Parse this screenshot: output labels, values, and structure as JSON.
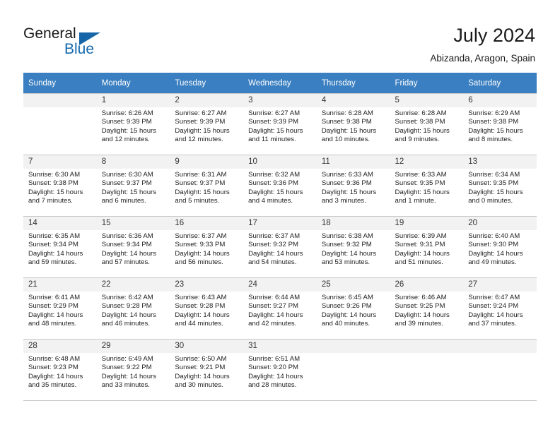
{
  "brand": {
    "name_part1": "General",
    "name_part2": "Blue",
    "triangle_color": "#1565a8",
    "blue_text_color": "#1268ad"
  },
  "header": {
    "title": "July 2024",
    "subtitle": "Abizanda, Aragon, Spain"
  },
  "calendar": {
    "header_bg": "#3a7fc1",
    "daynum_bg": "#f2f2f2",
    "weekday_headers": [
      "Sunday",
      "Monday",
      "Tuesday",
      "Wednesday",
      "Thursday",
      "Friday",
      "Saturday"
    ],
    "weeks": [
      [
        {
          "day": "",
          "details": ""
        },
        {
          "day": "1",
          "details": "Sunrise: 6:26 AM\nSunset: 9:39 PM\nDaylight: 15 hours\nand 12 minutes."
        },
        {
          "day": "2",
          "details": "Sunrise: 6:27 AM\nSunset: 9:39 PM\nDaylight: 15 hours\nand 12 minutes."
        },
        {
          "day": "3",
          "details": "Sunrise: 6:27 AM\nSunset: 9:39 PM\nDaylight: 15 hours\nand 11 minutes."
        },
        {
          "day": "4",
          "details": "Sunrise: 6:28 AM\nSunset: 9:38 PM\nDaylight: 15 hours\nand 10 minutes."
        },
        {
          "day": "5",
          "details": "Sunrise: 6:28 AM\nSunset: 9:38 PM\nDaylight: 15 hours\nand 9 minutes."
        },
        {
          "day": "6",
          "details": "Sunrise: 6:29 AM\nSunset: 9:38 PM\nDaylight: 15 hours\nand 8 minutes."
        }
      ],
      [
        {
          "day": "7",
          "details": "Sunrise: 6:30 AM\nSunset: 9:38 PM\nDaylight: 15 hours\nand 7 minutes."
        },
        {
          "day": "8",
          "details": "Sunrise: 6:30 AM\nSunset: 9:37 PM\nDaylight: 15 hours\nand 6 minutes."
        },
        {
          "day": "9",
          "details": "Sunrise: 6:31 AM\nSunset: 9:37 PM\nDaylight: 15 hours\nand 5 minutes."
        },
        {
          "day": "10",
          "details": "Sunrise: 6:32 AM\nSunset: 9:36 PM\nDaylight: 15 hours\nand 4 minutes."
        },
        {
          "day": "11",
          "details": "Sunrise: 6:33 AM\nSunset: 9:36 PM\nDaylight: 15 hours\nand 3 minutes."
        },
        {
          "day": "12",
          "details": "Sunrise: 6:33 AM\nSunset: 9:35 PM\nDaylight: 15 hours\nand 1 minute."
        },
        {
          "day": "13",
          "details": "Sunrise: 6:34 AM\nSunset: 9:35 PM\nDaylight: 15 hours\nand 0 minutes."
        }
      ],
      [
        {
          "day": "14",
          "details": "Sunrise: 6:35 AM\nSunset: 9:34 PM\nDaylight: 14 hours\nand 59 minutes."
        },
        {
          "day": "15",
          "details": "Sunrise: 6:36 AM\nSunset: 9:34 PM\nDaylight: 14 hours\nand 57 minutes."
        },
        {
          "day": "16",
          "details": "Sunrise: 6:37 AM\nSunset: 9:33 PM\nDaylight: 14 hours\nand 56 minutes."
        },
        {
          "day": "17",
          "details": "Sunrise: 6:37 AM\nSunset: 9:32 PM\nDaylight: 14 hours\nand 54 minutes."
        },
        {
          "day": "18",
          "details": "Sunrise: 6:38 AM\nSunset: 9:32 PM\nDaylight: 14 hours\nand 53 minutes."
        },
        {
          "day": "19",
          "details": "Sunrise: 6:39 AM\nSunset: 9:31 PM\nDaylight: 14 hours\nand 51 minutes."
        },
        {
          "day": "20",
          "details": "Sunrise: 6:40 AM\nSunset: 9:30 PM\nDaylight: 14 hours\nand 49 minutes."
        }
      ],
      [
        {
          "day": "21",
          "details": "Sunrise: 6:41 AM\nSunset: 9:29 PM\nDaylight: 14 hours\nand 48 minutes."
        },
        {
          "day": "22",
          "details": "Sunrise: 6:42 AM\nSunset: 9:28 PM\nDaylight: 14 hours\nand 46 minutes."
        },
        {
          "day": "23",
          "details": "Sunrise: 6:43 AM\nSunset: 9:28 PM\nDaylight: 14 hours\nand 44 minutes."
        },
        {
          "day": "24",
          "details": "Sunrise: 6:44 AM\nSunset: 9:27 PM\nDaylight: 14 hours\nand 42 minutes."
        },
        {
          "day": "25",
          "details": "Sunrise: 6:45 AM\nSunset: 9:26 PM\nDaylight: 14 hours\nand 40 minutes."
        },
        {
          "day": "26",
          "details": "Sunrise: 6:46 AM\nSunset: 9:25 PM\nDaylight: 14 hours\nand 39 minutes."
        },
        {
          "day": "27",
          "details": "Sunrise: 6:47 AM\nSunset: 9:24 PM\nDaylight: 14 hours\nand 37 minutes."
        }
      ],
      [
        {
          "day": "28",
          "details": "Sunrise: 6:48 AM\nSunset: 9:23 PM\nDaylight: 14 hours\nand 35 minutes."
        },
        {
          "day": "29",
          "details": "Sunrise: 6:49 AM\nSunset: 9:22 PM\nDaylight: 14 hours\nand 33 minutes."
        },
        {
          "day": "30",
          "details": "Sunrise: 6:50 AM\nSunset: 9:21 PM\nDaylight: 14 hours\nand 30 minutes."
        },
        {
          "day": "31",
          "details": "Sunrise: 6:51 AM\nSunset: 9:20 PM\nDaylight: 14 hours\nand 28 minutes."
        },
        {
          "day": "",
          "details": ""
        },
        {
          "day": "",
          "details": ""
        },
        {
          "day": "",
          "details": ""
        }
      ]
    ]
  }
}
